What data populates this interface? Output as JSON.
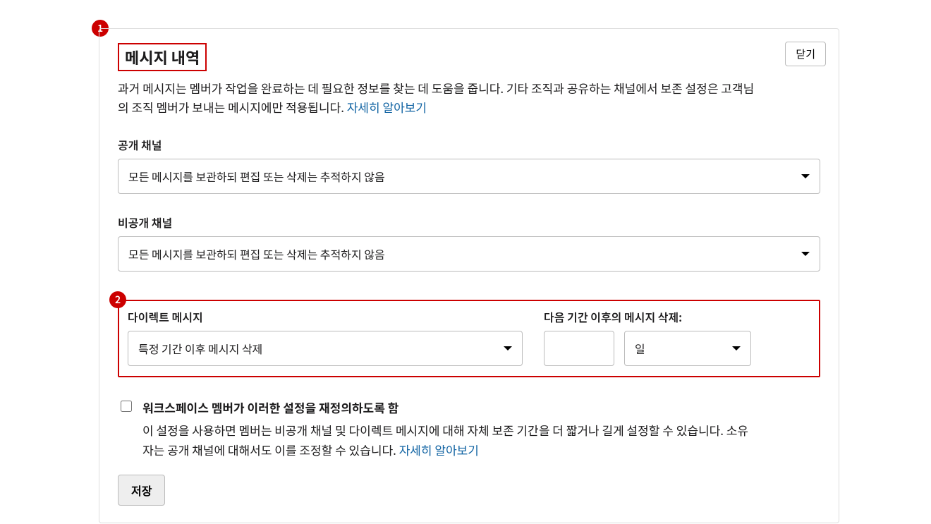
{
  "buttons": {
    "close": "닫기",
    "save": "저장"
  },
  "header": {
    "title": "메시지 내역",
    "description_1": "과거 메시지는 멤버가 작업을 완료하는 데 필요한 정보를 찾는 데 도움을 줍니다. 기타 조직과 공유하는 채널에서 보존 설정은 고객님의 조직 멤버가 보내는 메시지에만 적용됩니다. ",
    "learn_more": "자세히 알아보기"
  },
  "badges": {
    "one": "1",
    "two": "2"
  },
  "public_channel": {
    "label": "공개 채널",
    "selected": "모든 메시지를 보관하되 편집 또는 삭제는 추적하지 않음"
  },
  "private_channel": {
    "label": "비공개 채널",
    "selected": "모든 메시지를 보관하되 편집 또는 삭제는 추적하지 않음"
  },
  "direct_message": {
    "label": "다이렉트 메시지",
    "selected": "특정 기간 이후 메시지 삭제",
    "delete_after_label": "다음 기간 이후의 메시지 삭제:",
    "number_value": "",
    "unit_selected": "일"
  },
  "override": {
    "checkbox_label": "워크스페이스 멤버가 이러한 설정을 재정의하도록 함",
    "description": "이 설정을 사용하면 멤버는 비공개 채널 및 다이렉트 메시지에 대해 자체 보존 기간을 더 짧거나 길게 설정할 수 있습니다. 소유자는 공개 채널에 대해서도 이를 조정할 수 있습니다. ",
    "learn_more": "자세히 알아보기"
  }
}
